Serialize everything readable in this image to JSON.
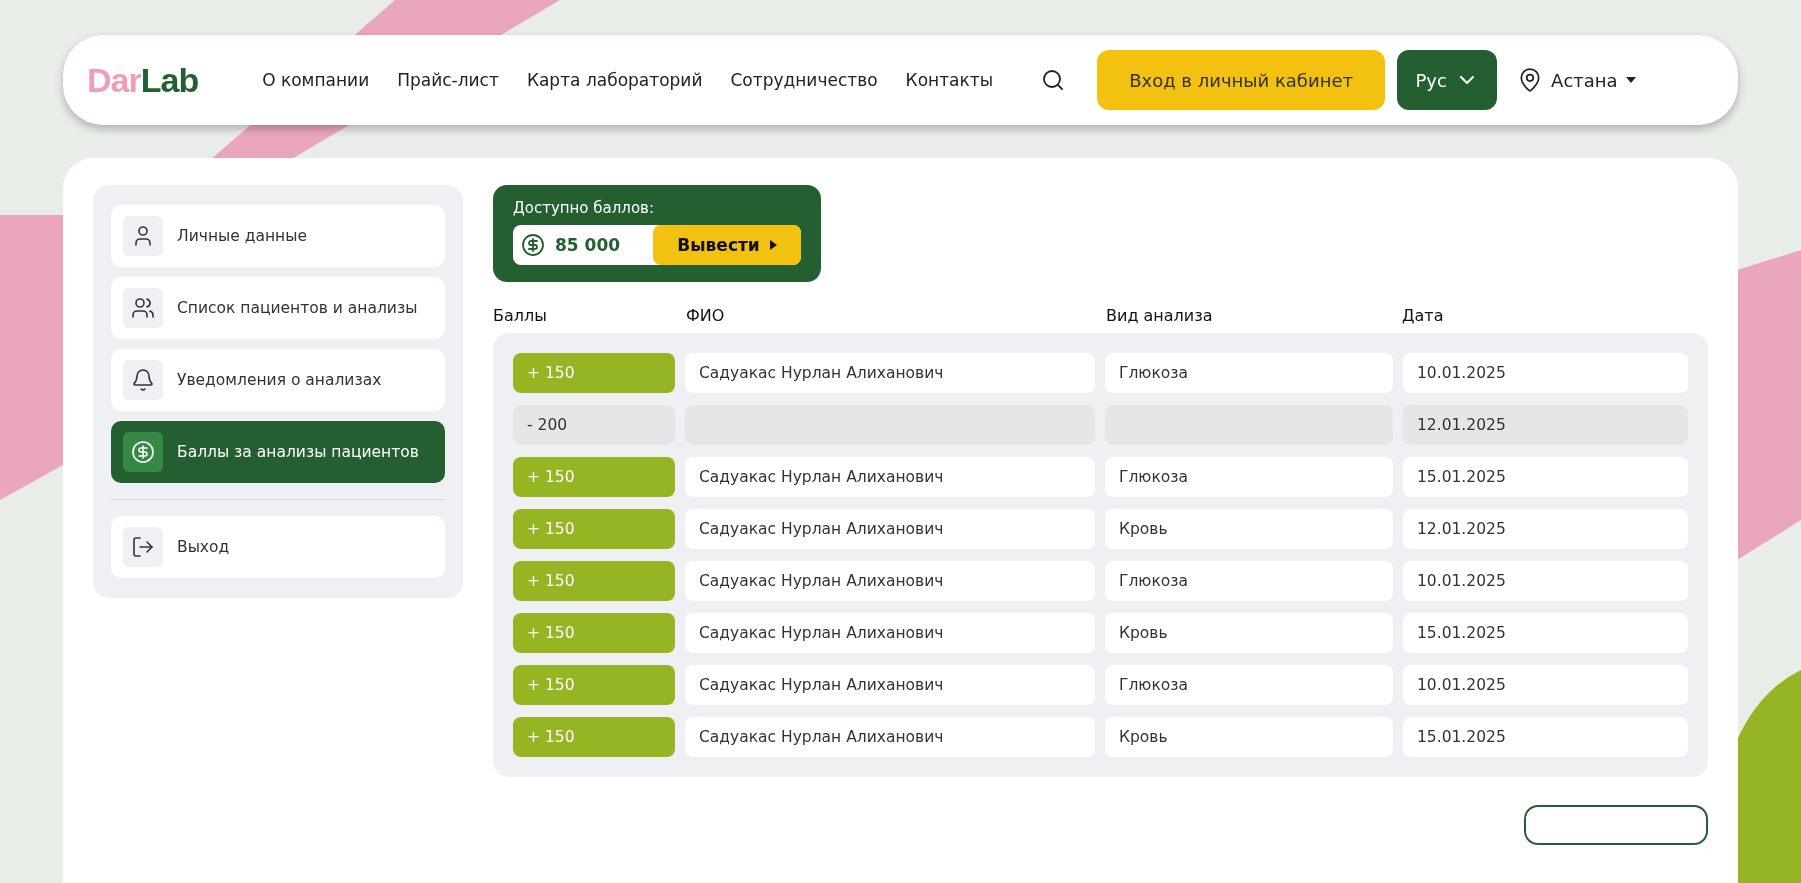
{
  "header": {
    "logo": {
      "part_1": "Dar",
      "part_2": "Lab"
    },
    "nav": [
      "О компании",
      "Прайс-лист",
      "Карта лабораторий",
      "Сотрудничество",
      "Контакты"
    ],
    "login_button": "Вход в личный кабинет",
    "language": "Рус",
    "city": "Астана"
  },
  "sidebar": {
    "items": [
      {
        "label": "Личные данные",
        "selected": false
      },
      {
        "label": "Список пациентов и анализы",
        "selected": false
      },
      {
        "label": "Уведомления о анализах",
        "selected": false
      },
      {
        "label": "Баллы за анализы пациентов",
        "selected": true
      }
    ],
    "logout": "Выход"
  },
  "balance": {
    "title": "Доступно баллов:",
    "amount": "85 000",
    "button": "Вывести"
  },
  "table": {
    "columns": [
      "Баллы",
      "ФИО",
      "Вид анализа",
      "Дата"
    ],
    "rows": [
      {
        "kind": "credit",
        "points": "+ 150",
        "name": "Садуакас Нурлан Алиханович",
        "analysis": "Глюкоза",
        "date": "10.01.2025"
      },
      {
        "kind": "debit",
        "points": "- 200",
        "date": "12.01.2025"
      },
      {
        "kind": "credit",
        "points": "+ 150",
        "name": "Садуакас Нурлан Алиханович",
        "analysis": "Глюкоза",
        "date": "15.01.2025"
      },
      {
        "kind": "credit",
        "points": "+ 150",
        "name": "Садуакас Нурлан Алиханович",
        "analysis": "Кровь",
        "date": "12.01.2025"
      },
      {
        "kind": "credit",
        "points": "+ 150",
        "name": "Садуакас Нурлан Алиханович",
        "analysis": "Глюкоза",
        "date": "10.01.2025"
      },
      {
        "kind": "credit",
        "points": "+ 150",
        "name": "Садуакас Нурлан Алиханович",
        "analysis": "Кровь",
        "date": "15.01.2025"
      },
      {
        "kind": "credit",
        "points": "+ 150",
        "name": "Садуакас Нурлан Алиханович",
        "analysis": "Глюкоза",
        "date": "10.01.2025"
      },
      {
        "kind": "credit",
        "points": "+ 150",
        "name": "Садуакас Нурлан Алиханович",
        "analysis": "Кровь",
        "date": "15.01.2025"
      }
    ]
  }
}
